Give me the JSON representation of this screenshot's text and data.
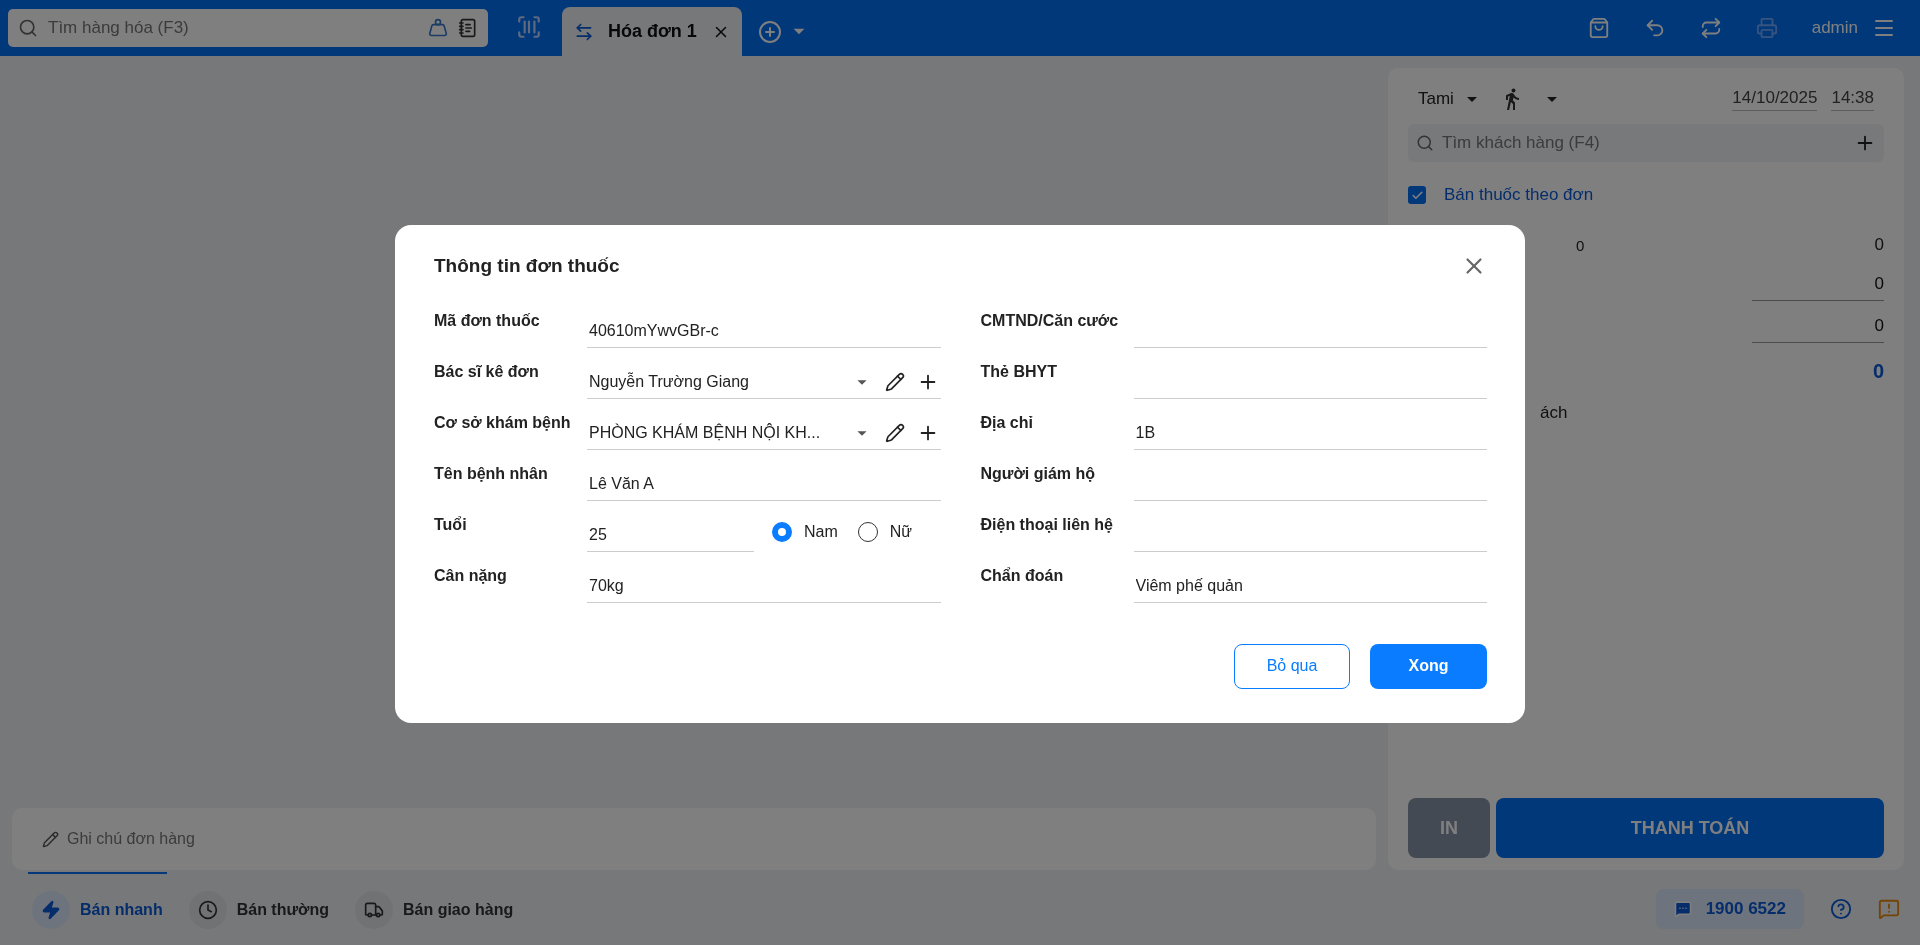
{
  "top_bar": {
    "search": {
      "placeholder": "Tìm hàng hóa (F3)"
    },
    "tabs": [
      {
        "label": "Hóa đơn 1",
        "selected": true
      }
    ],
    "user": "admin"
  },
  "side_panel": {
    "seller": "Tami",
    "date": "14/10/2025",
    "time": "14:38",
    "customer_search": {
      "placeholder": "Tìm khách hàng (F4)"
    },
    "prescription": {
      "label": "Bán thuốc theo đơn",
      "checked": true
    },
    "summary": [
      {
        "kind": "count",
        "count": "0",
        "value": "0"
      },
      {
        "kind": "input",
        "value": "0"
      },
      {
        "kind": "input",
        "value": "0"
      },
      {
        "kind": "total",
        "value": "0"
      },
      {
        "kind": "label",
        "label": "ách"
      }
    ],
    "print_button": "IN",
    "pay_button": "THANH TOÁN"
  },
  "note": {
    "placeholder": "Ghi chú đơn hàng"
  },
  "bottom_tabs": [
    {
      "label": "Bán nhanh",
      "selected": true
    },
    {
      "label": "Bán thường",
      "selected": false
    },
    {
      "label": "Bán giao hàng",
      "selected": false
    }
  ],
  "hotline": "1900 6522",
  "dialog": {
    "title": "Thông tin đơn thuốc",
    "left_fields": [
      {
        "kind": "text",
        "label": "Mã đơn thuốc",
        "value": "40610mYwvGBr-c"
      },
      {
        "kind": "select",
        "label": "Bác sĩ kê đơn",
        "value": "Nguyễn Trường Giang"
      },
      {
        "kind": "select",
        "label": "Cơ sở khám bệnh",
        "value": "PHÒNG KHÁM BỆNH NỘI KH..."
      },
      {
        "kind": "text",
        "label": "Tên bệnh nhân",
        "value": "Lê Văn A"
      },
      {
        "kind": "age",
        "label": "Tuổi",
        "value": "25"
      },
      {
        "kind": "text",
        "label": "Cân nặng",
        "value": "70kg"
      }
    ],
    "gender": [
      {
        "label": "Nam",
        "selected": true
      },
      {
        "label": "Nữ",
        "selected": false
      }
    ],
    "right_fields": [
      {
        "kind": "text",
        "label": "CMTND/Căn cước"
      },
      {
        "kind": "text",
        "label": "Thẻ BHYT"
      },
      {
        "kind": "text",
        "label": "Địa chỉ",
        "value": "1B"
      },
      {
        "kind": "text",
        "label": "Người giám hộ"
      },
      {
        "kind": "text",
        "label": "Điện thoại liên hệ"
      },
      {
        "kind": "text",
        "label": "Chẩn đoán",
        "value": "Viêm phế quản"
      }
    ],
    "cancel_button": "Bỏ qua",
    "done_button": "Xong"
  }
}
